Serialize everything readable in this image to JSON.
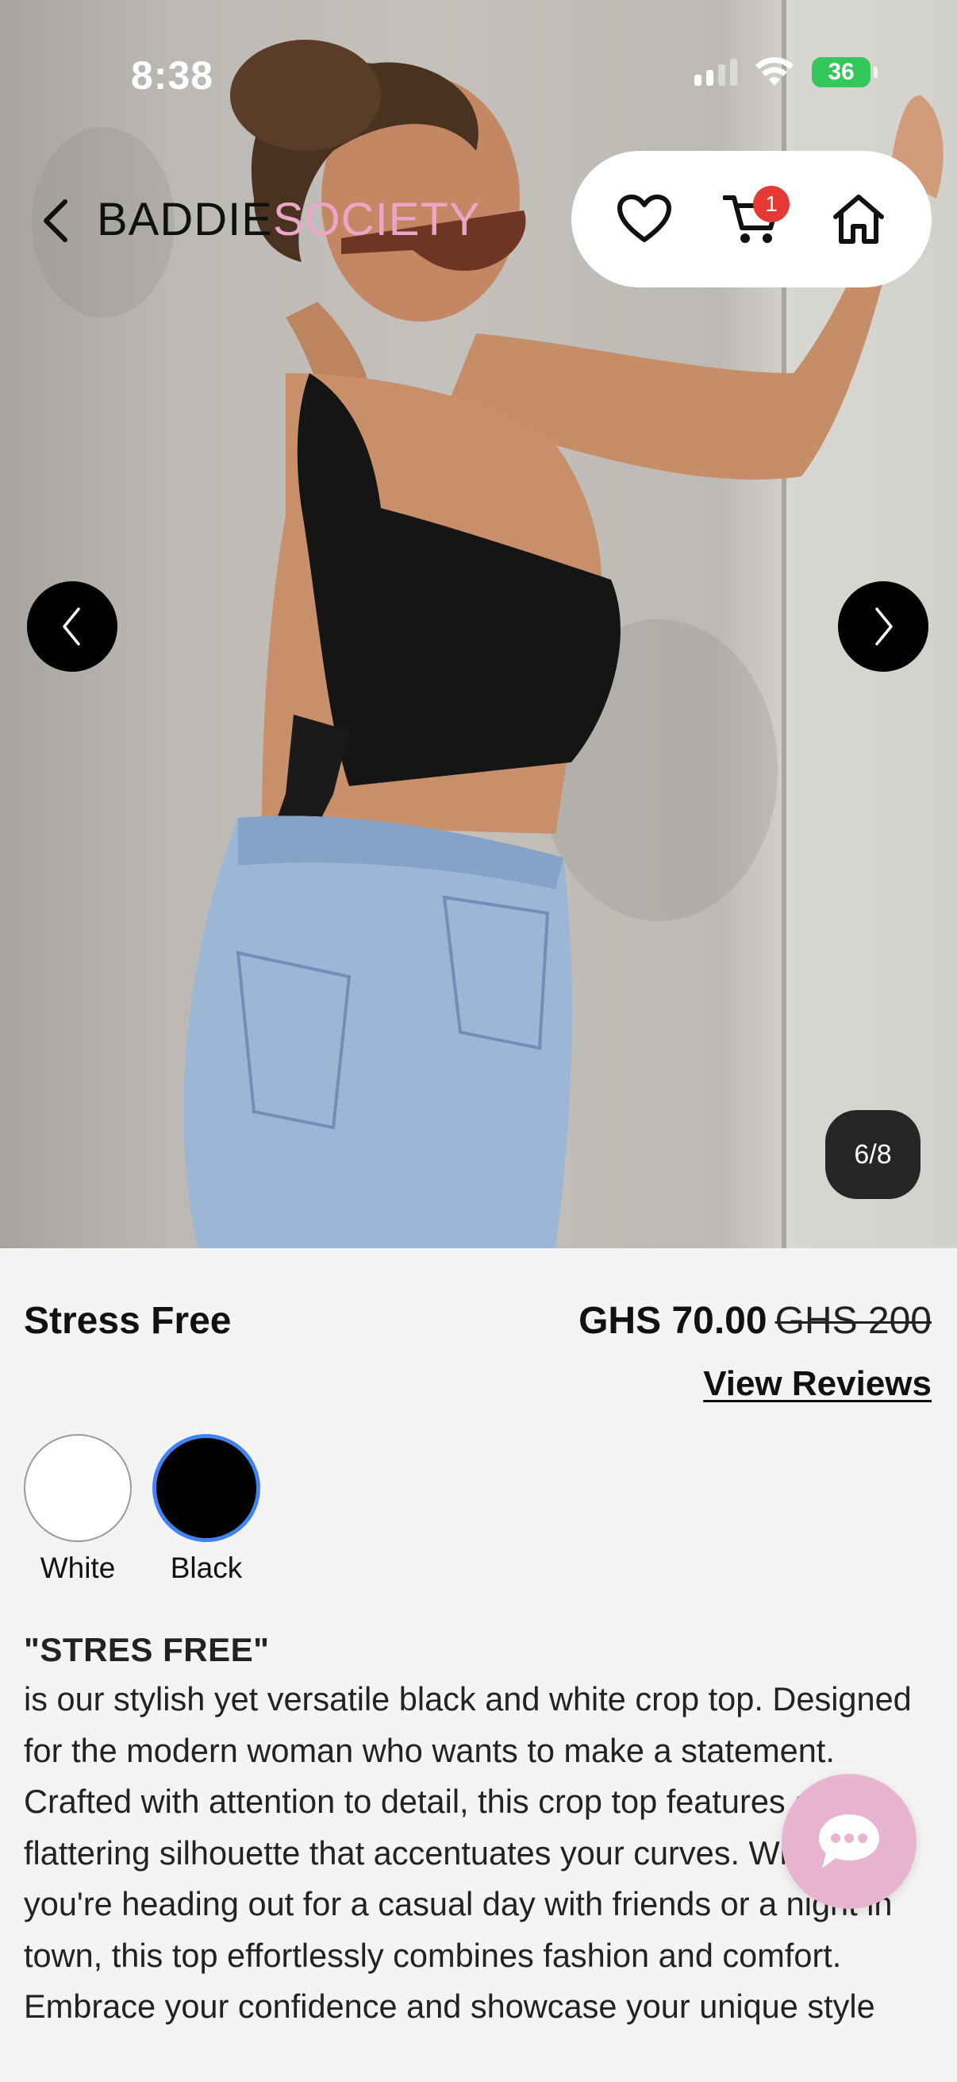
{
  "status_bar": {
    "time": "8:38",
    "battery": "36"
  },
  "header": {
    "brand_part1": "BADDIE",
    "brand_part2": "SOCIETY",
    "cart_count": "1"
  },
  "carousel": {
    "counter": "6/8"
  },
  "product": {
    "name": "Stress Free",
    "price": "GHS 70.00",
    "original_price": "GHS 200",
    "reviews_link": "View Reviews",
    "colors": [
      {
        "label": "White",
        "hex": "#ffffff",
        "selected": false
      },
      {
        "label": "Black",
        "hex": "#000000",
        "selected": true
      }
    ],
    "description_title": "\"STRES FREE\"",
    "description": "is our stylish yet versatile black and white crop top. Designed for the modern woman who wants to make a statement. Crafted with attention to detail, this crop top features a flattering silhouette that accentuates your curves. Whether you're heading out for a casual day with friends or a night in town, this top effortlessly combines fashion and comfort. Embrace your confidence and showcase your unique style"
  },
  "icons": [
    "chevron-left-icon",
    "heart-icon",
    "cart-icon",
    "home-icon",
    "arrow-left-icon",
    "arrow-right-icon",
    "chat-icon",
    "signal-icon",
    "wifi-icon",
    "battery-icon"
  ],
  "colors": {
    "brand_pink": "#e9a6c6",
    "badge_red": "#e53935",
    "chat_fab": "#e9b4cf",
    "selected_ring": "#3f84f4"
  }
}
